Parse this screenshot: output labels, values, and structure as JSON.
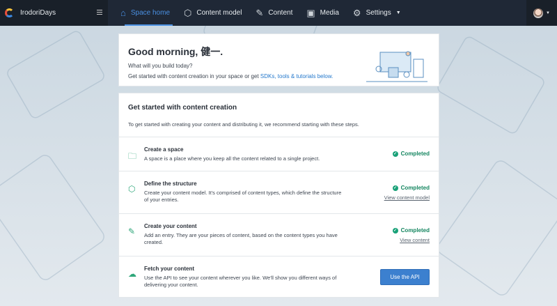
{
  "nav": {
    "space_name": "IrodoriDays",
    "tabs": [
      {
        "label": "Space home",
        "icon": "home-icon"
      },
      {
        "label": "Content model",
        "icon": "box-icon"
      },
      {
        "label": "Content",
        "icon": "edit-icon"
      },
      {
        "label": "Media",
        "icon": "image-icon"
      },
      {
        "label": "Settings",
        "icon": "gear-icon"
      }
    ]
  },
  "welcome": {
    "title": "Good morning, 健一.",
    "subtitle": "What will you build today?",
    "text": "Get started with content creation in your space or get ",
    "link": "SDKs, tools & tutorials below."
  },
  "steps": {
    "title": "Get started with content creation",
    "intro": "To get started with creating your content and distributing it, we recommend starting with these steps.",
    "items": [
      {
        "title": "Create a space",
        "desc": "A space is a place where you keep all the content related to a single project.",
        "status": "Completed"
      },
      {
        "title": "Define the structure",
        "desc": "Create your content model. It's comprised of content types, which define the structure of your entries.",
        "status": "Completed",
        "link": "View content model"
      },
      {
        "title": "Create your content",
        "desc": "Add an entry. They are your pieces of content, based on the content types you have created.",
        "status": "Completed",
        "link": "View content"
      },
      {
        "title": "Fetch your content",
        "desc": "Use the API to see your content wherever you like. We'll show you different ways of delivering your content.",
        "button": "Use the API"
      }
    ]
  },
  "colors": {
    "nav": "#1f2836",
    "accent": "#4a90e2",
    "success": "#14855f",
    "button": "#3c80cf"
  }
}
